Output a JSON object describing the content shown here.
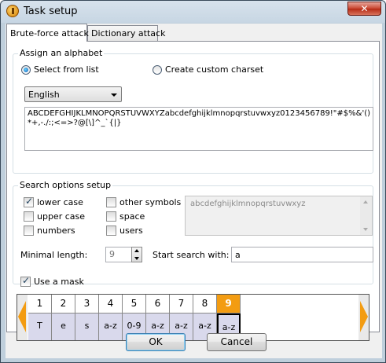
{
  "window": {
    "title": "Task setup",
    "close_glyph": "✕"
  },
  "tabs": [
    {
      "label": "Brute-force attack"
    },
    {
      "label": "Dictionary attack"
    }
  ],
  "alphabet": {
    "title": "Assign an alphabet",
    "select_from_list": "Select from list",
    "create_custom": "Create custom charset",
    "language": "English",
    "charset": "ABCDEFGHIJKLMNOPQRSTUVWXYZabcdefghijklmnopqrstuvwxyz0123456789!\"#$%&'()*+,-./:;<=>?@[\\]^_`{|}"
  },
  "search": {
    "title": "Search options setup",
    "lower_case": "lower case",
    "upper_case": "upper case",
    "numbers": "numbers",
    "other_symbols": "other symbols",
    "space": "space",
    "users": "users",
    "preview": "abcdefghijklmnopqrstuvwxyz",
    "min_length_label": "Minimal length:",
    "min_length_value": "9",
    "start_with_label": "Start search with:",
    "start_with_value": "a"
  },
  "mask": {
    "label": "Use a mask",
    "columns": [
      {
        "num": "1",
        "val": "T"
      },
      {
        "num": "2",
        "val": "e"
      },
      {
        "num": "3",
        "val": "s"
      },
      {
        "num": "4",
        "val": "a-z"
      },
      {
        "num": "5",
        "val": "0-9"
      },
      {
        "num": "6",
        "val": "a-z"
      },
      {
        "num": "7",
        "val": "a-z"
      },
      {
        "num": "8",
        "val": "a-z"
      },
      {
        "num": "9",
        "val": "a-z"
      }
    ]
  },
  "buttons": {
    "ok": "OK",
    "cancel": "Cancel"
  },
  "colors": {
    "accent": "#f39c12",
    "mask_cell": "#d9d9ec"
  }
}
